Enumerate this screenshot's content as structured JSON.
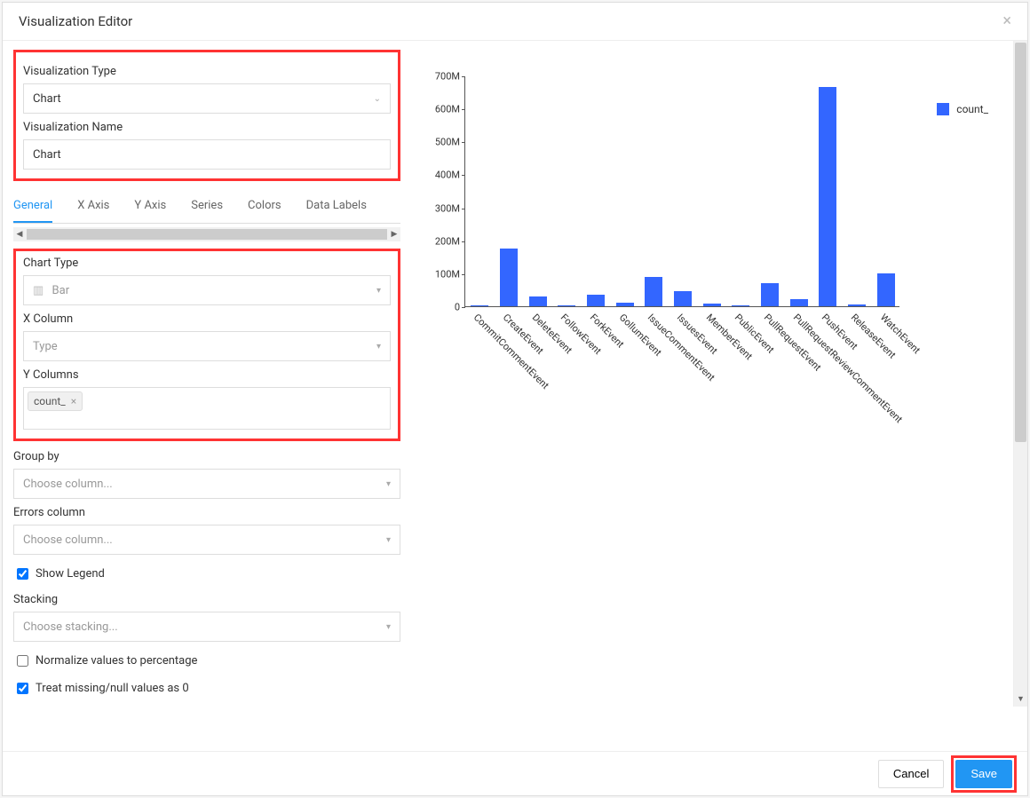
{
  "header": {
    "title": "Visualization Editor"
  },
  "form": {
    "viz_type_label": "Visualization Type",
    "viz_type_value": "Chart",
    "viz_name_label": "Visualization Name",
    "viz_name_value": "Chart",
    "tabs": {
      "general": "General",
      "xaxis": "X Axis",
      "yaxis": "Y Axis",
      "series": "Series",
      "colors": "Colors",
      "datalabels": "Data Labels"
    },
    "chart_type_label": "Chart Type",
    "chart_type_value": "Bar",
    "x_column_label": "X Column",
    "x_column_value": "Type",
    "y_columns_label": "Y Columns",
    "y_columns_tag": "count_",
    "group_by_label": "Group by",
    "group_by_placeholder": "Choose column...",
    "errors_column_label": "Errors column",
    "errors_column_placeholder": "Choose column...",
    "show_legend_label": "Show Legend",
    "stacking_label": "Stacking",
    "stacking_placeholder": "Choose stacking...",
    "normalize_label": "Normalize values to percentage",
    "treat_missing_label": "Treat missing/null values as 0"
  },
  "checkboxes": {
    "show_legend": true,
    "normalize": false,
    "treat_missing": true
  },
  "footer": {
    "cancel_label": "Cancel",
    "save_label": "Save"
  },
  "chart_data": {
    "type": "bar",
    "legend_label": "count_",
    "ylim": [
      0,
      700000000
    ],
    "y_ticks": [
      "0",
      "100M",
      "200M",
      "300M",
      "400M",
      "500M",
      "600M",
      "700M"
    ],
    "categories": [
      "CommitCommentEvent",
      "CreateEvent",
      "DeleteEvent",
      "FollowEvent",
      "ForkEvent",
      "GollumEvent",
      "IssueCommentEvent",
      "IssuesEvent",
      "MemberEvent",
      "PublicEvent",
      "PullRequestEvent",
      "PullRequestReviewCommentEvent",
      "PushEvent",
      "ReleaseEvent",
      "WatchEvent"
    ],
    "values": [
      4000000,
      175000000,
      30000000,
      2000000,
      35000000,
      10000000,
      90000000,
      45000000,
      8000000,
      3000000,
      70000000,
      22000000,
      665000000,
      6000000,
      100000000
    ],
    "color": "#3366ff"
  }
}
